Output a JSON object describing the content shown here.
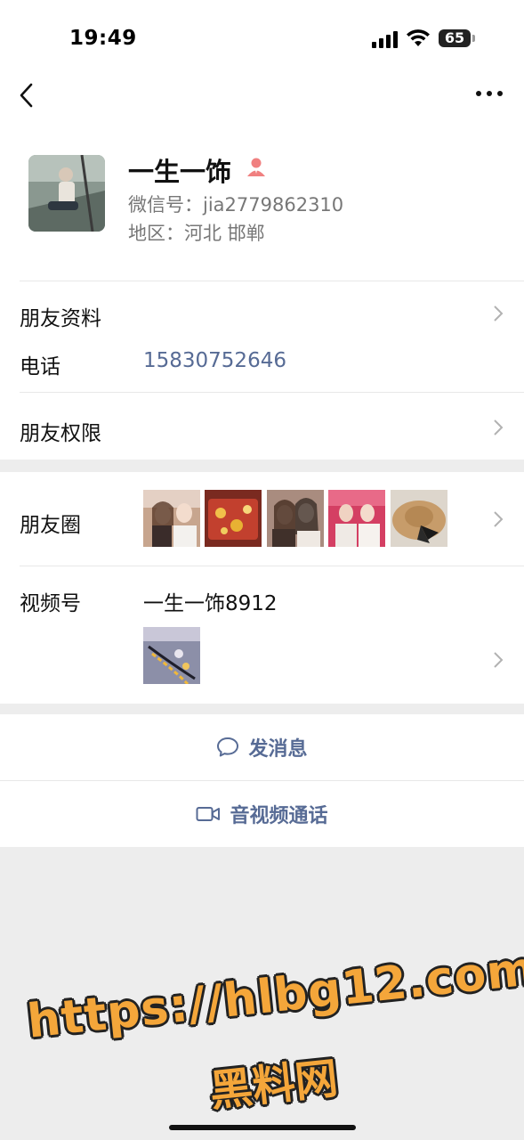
{
  "status_bar": {
    "time": "19:49",
    "battery": "65"
  },
  "nav": {
    "back_icon": "chevron-left-icon",
    "more_icon": "more-dots-icon"
  },
  "profile": {
    "name": "一生一饰",
    "wechat_id": "微信号：jia2779862310",
    "region": "地区：河北 邯郸",
    "badge_icon": "person-icon",
    "badge_color": "#f08080"
  },
  "rows": {
    "friend_info_label": "朋友资料",
    "phone_label": "电话",
    "phone_value": "15830752646",
    "permissions_label": "朋友权限",
    "moments_label": "朋友圈",
    "channels_label": "视频号",
    "channels_name": "一生一饰8912"
  },
  "actions": {
    "message_label": "发消息",
    "message_icon": "chat-bubble-icon",
    "call_label": "音视频通话",
    "call_icon": "video-camera-icon"
  },
  "watermark": {
    "url": "https://hlbg12.com",
    "name": "黑料网"
  },
  "colors": {
    "link": "#576b95",
    "background": "#ededed"
  }
}
